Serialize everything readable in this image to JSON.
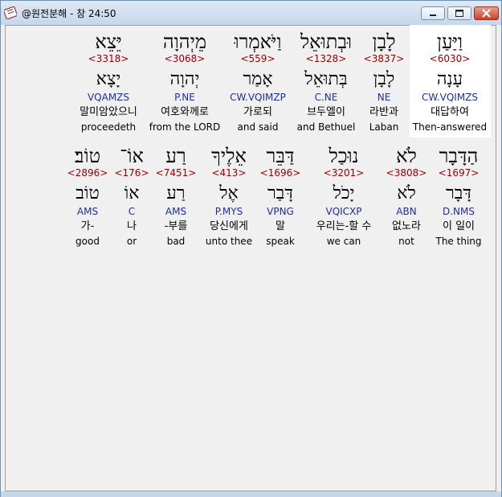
{
  "window": {
    "title": "@원전분해 - 창 24:50"
  },
  "icons": {
    "app": "bible-app-icon",
    "minimize": "minimize-icon",
    "maximize": "maximize-icon",
    "close": "close-icon"
  },
  "rows": [
    {
      "words": [
        {
          "hebrew": "יֵּצֵא",
          "strong": "<3318>",
          "lemma": "יָצָא",
          "parse": "VQAMZS",
          "korean": "말미암았으니",
          "english": "proceedeth"
        },
        {
          "hebrew": "מֵיְהוָה",
          "strong": "<3068>",
          "lemma": "יְהוָה",
          "parse": "P.NE",
          "korean": "여호와께로",
          "english": "from the LORD"
        },
        {
          "hebrew": "וַיֹּאמְרוּ",
          "strong": "<559>",
          "lemma": "אָמַר",
          "parse": "CW.VQIMZP",
          "korean": "가로되",
          "english": "and said"
        },
        {
          "hebrew": "וּבְתוּאֵל",
          "strong": "<1328>",
          "lemma": "בְּתוּאֵל",
          "parse": "C.NE",
          "korean": "브두엘이",
          "english": "and Bethuel"
        },
        {
          "hebrew": "לָבָן",
          "strong": "<3837>",
          "lemma": "לָבָן",
          "parse": "NE",
          "korean": "라반과",
          "english": "Laban"
        },
        {
          "hebrew": "וַיַּעַן",
          "strong": "<6030>",
          "lemma": "עָנָה",
          "parse": "CW.VQIMZS",
          "korean": "대답하여",
          "english": "Then-answered"
        }
      ]
    },
    {
      "words": [
        {
          "hebrew": "טוֹב׃",
          "strong": "<2896>",
          "lemma": "טוֹב",
          "parse": "AMS",
          "korean": "가-",
          "english": "good"
        },
        {
          "hebrew": "אוֹ־",
          "strong": "<176>",
          "lemma": "אוֹ",
          "parse": "C",
          "korean": "나",
          "english": "or"
        },
        {
          "hebrew": "רַע",
          "strong": "<7451>",
          "lemma": "רַע",
          "parse": "AMS",
          "korean": "-부를",
          "english": "bad"
        },
        {
          "hebrew": "אֵלֶיךָ",
          "strong": "<413>",
          "lemma": "אֶל",
          "parse": "P.MYS",
          "korean": "당신에게",
          "english": "unto thee"
        },
        {
          "hebrew": "דַּבֵּר",
          "strong": "<1696>",
          "lemma": "דָּבַר",
          "parse": "VPNG",
          "korean": "말",
          "english": "speak"
        },
        {
          "hebrew": "נוּכַל",
          "strong": "<3201>",
          "lemma": "יָכֹל",
          "parse": "VQICXP",
          "korean": "우리는-할 수",
          "english": "we can"
        },
        {
          "hebrew": "לֹא",
          "strong": "<3808>",
          "lemma": "לֹא",
          "parse": "ABN",
          "korean": "없노라",
          "english": "not"
        },
        {
          "hebrew": "הַדָּבָר",
          "strong": "<1697>",
          "lemma": "דָּבָר",
          "parse": "D.NMS",
          "korean": "이 일이",
          "english": "The thing"
        }
      ]
    }
  ]
}
